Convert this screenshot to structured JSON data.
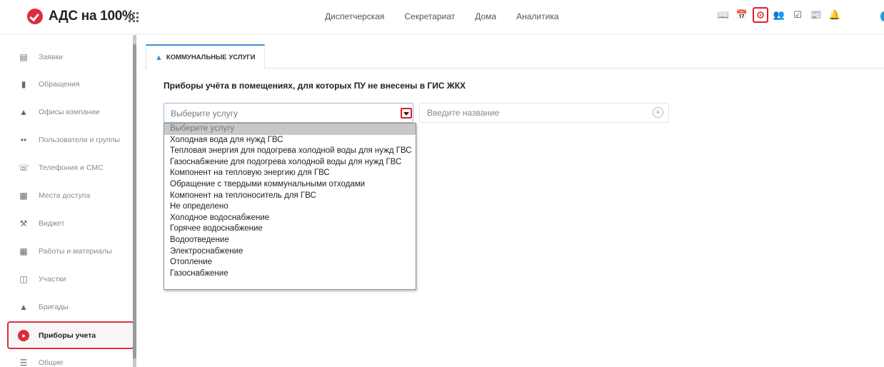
{
  "header": {
    "logo_text": "АДС на 100%",
    "nav": [
      "Диспетчерская",
      "Секретариат",
      "Дома",
      "Аналитика"
    ],
    "icons": [
      "book-icon",
      "calendar-icon",
      "gear-icon",
      "users-icon",
      "checklist-icon",
      "newspaper-icon",
      "bell-icon"
    ],
    "selected_icon": "gear-icon",
    "accent_color": "#e11d2b"
  },
  "sidebar": {
    "items": [
      {
        "label": "Заявки",
        "icon": "books-icon"
      },
      {
        "label": "Обращения",
        "icon": "document-icon"
      },
      {
        "label": "Офисы компании",
        "icon": "office-icon"
      },
      {
        "label": "Пользователи и группы",
        "icon": "users-icon"
      },
      {
        "label": "Телефония и СМС",
        "icon": "phone-icon"
      },
      {
        "label": "Места доступа",
        "icon": "door-icon"
      },
      {
        "label": "Виджет",
        "icon": "wrench-icon"
      },
      {
        "label": "Работы и материалы",
        "icon": "calculator-icon"
      },
      {
        "label": "Участки",
        "icon": "sitemap-icon"
      },
      {
        "label": "Бригады",
        "icon": "helmet-icon"
      },
      {
        "label": "Приборы учета",
        "icon": "gauge-icon"
      },
      {
        "label": "Общие",
        "icon": "menu-icon"
      }
    ],
    "active_index": 10
  },
  "main": {
    "tab_label": "КОММУНАЛЬНЫЕ УСЛУГИ",
    "section_title": "Приборы учёта в помещениях, для которых ПУ не внесены в ГИС ЖКХ",
    "service_select": {
      "value": "Выберите услугу",
      "options": [
        "Выберите услугу",
        "Холодная вода для нужд ГВС",
        "Тепловая энергия для подогрева холодной воды для нужд ГВС",
        "Газоснабжение для подогрева холодной воды для нужд ГВС",
        "Компонент на тепловую энергию для ГВС",
        "Обращение с твердыми коммунальными отходами",
        "Компонент на теплоноситель для ГВС",
        "Не определено",
        "Холодное водоснабжение",
        "Горячее водоснабжение",
        "Водоотведение",
        "Электроснабжение",
        "Отопление",
        "Газоснабжение"
      ]
    },
    "name_input": {
      "placeholder": "Введите название",
      "value": ""
    }
  }
}
